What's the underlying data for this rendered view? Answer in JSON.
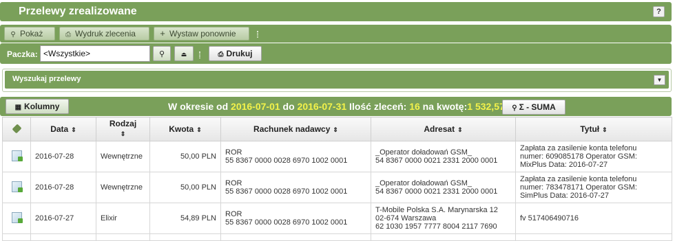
{
  "title": "Przelewy zrealizowane",
  "help_label": "?",
  "toolbar": {
    "show_label": "Pokaż",
    "print_order_label": "Wydruk zlecenia",
    "reissue_label": "Wystaw ponownie"
  },
  "batch": {
    "label": "Paczka:",
    "value": "<Wszystkie>",
    "print_label": "Drukuj"
  },
  "search_panel": {
    "title": "Wyszukaj przelewy"
  },
  "summary": {
    "columns_label": "Kolumny",
    "p1": "W okresie od ",
    "date_from": "2016-07-01",
    "p2": " do ",
    "date_to": "2016-07-31",
    "p3": " Ilość zleceń: ",
    "count": "16",
    "p4": " na kwotę:",
    "amount": "1 532,57",
    "sum_label": "Σ - SUMA"
  },
  "table": {
    "headers": {
      "date": "Data",
      "type_line1": "Rodzaj",
      "amount": "Kwota",
      "sender_account": "Rachunek nadawcy",
      "recipient": "Adresat",
      "title": "Tytuł"
    },
    "rows": [
      {
        "date": "2016-07-28",
        "type": "Wewnętrzne",
        "amount": "50,00 PLN",
        "sender1": "ROR",
        "sender2": "55 8367 0000 0028 6970 1002 0001",
        "rec1": "_Operator doładowań GSM_",
        "rec2": "54 8367 0000 0021 2331 2000 0001",
        "rec3": "",
        "title1": "Zapłata za zasilenie konta telefonu",
        "title2": "numer: 609085178 Operator GSM:",
        "title3": "MixPlus Data: 2016-07-27"
      },
      {
        "date": "2016-07-28",
        "type": "Wewnętrzne",
        "amount": "50,00 PLN",
        "sender1": "ROR",
        "sender2": "55 8367 0000 0028 6970 1002 0001",
        "rec1": "_Operator doładowań GSM_",
        "rec2": "54 8367 0000 0021 2331 2000 0001",
        "rec3": "",
        "title1": "Zapłata za zasilenie konta telefonu",
        "title2": "numer: 783478171 Operator GSM:",
        "title3": "SimPlus Data: 2016-07-27"
      },
      {
        "date": "2016-07-27",
        "type": "Elixir",
        "amount": "54,89 PLN",
        "sender1": "ROR",
        "sender2": "55 8367 0000 0028 6970 1002 0001",
        "rec1": "T-Mobile Polska S.A. Marynarska 12",
        "rec2": "02-674 Warszawa",
        "rec3": "62 1030 1957 7777 8004 2117 7690",
        "title1": "fv 517406490716",
        "title2": "",
        "title3": ""
      }
    ]
  }
}
